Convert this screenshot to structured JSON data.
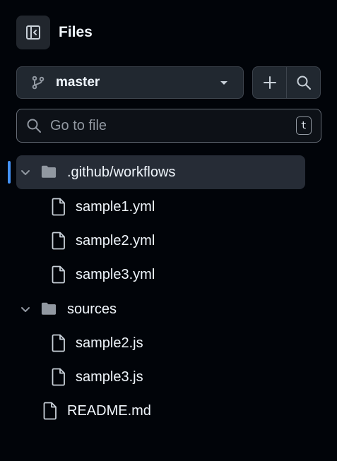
{
  "header": {
    "title": "Files",
    "toggle_icon": "sidebar-collapse-icon"
  },
  "branch": {
    "name": "master",
    "icon": "git-branch-icon"
  },
  "actions": {
    "add_icon": "plus-icon",
    "search_icon": "search-icon"
  },
  "search": {
    "placeholder": "Go to file",
    "value": "",
    "shortcut": "t"
  },
  "tree": {
    "items": [
      {
        "label": ".github/workflows",
        "type": "folder",
        "expanded": true,
        "selected": true,
        "depth": 0
      },
      {
        "label": "sample1.yml",
        "type": "file",
        "depth": 1
      },
      {
        "label": "sample2.yml",
        "type": "file",
        "depth": 1
      },
      {
        "label": "sample3.yml",
        "type": "file",
        "depth": 1
      },
      {
        "label": "sources",
        "type": "folder",
        "expanded": true,
        "selected": false,
        "depth": 0
      },
      {
        "label": "sample2.js",
        "type": "file",
        "depth": 1
      },
      {
        "label": "sample3.js",
        "type": "file",
        "depth": 1
      },
      {
        "label": "README.md",
        "type": "file",
        "depth": 0
      }
    ]
  },
  "colors": {
    "background": "#010409",
    "accent": "#4493f8",
    "selected_row": "#262c36",
    "border": "#3d444d"
  }
}
